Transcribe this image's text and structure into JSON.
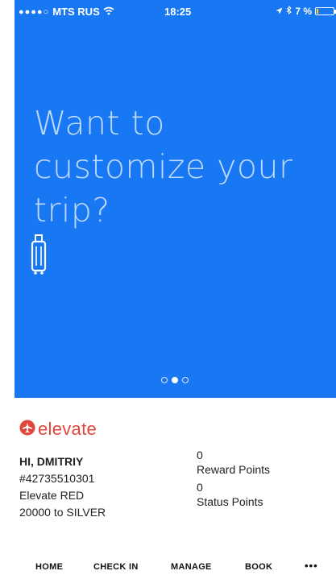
{
  "status_bar": {
    "carrier": "MTS RUS",
    "time": "18:25",
    "battery_text": "7 %",
    "battery_level": 0.07
  },
  "hero": {
    "headline_lines": [
      "Want to",
      "customize your",
      "trip?"
    ],
    "icon": "luggage-icon",
    "pager": {
      "total": 3,
      "active_index": 1
    },
    "background_color": "#1877f2"
  },
  "brand": {
    "name": "elevate",
    "color": "#e2463b"
  },
  "profile": {
    "greeting": "HI, DMITRIY",
    "member_number": "#42735510301",
    "tier": "Elevate RED",
    "progress": "20000 to SILVER"
  },
  "points": {
    "reward_value": "0",
    "reward_label": "Reward Points",
    "status_value": "0",
    "status_label": "Status Points"
  },
  "tabbar": {
    "home": "HOME",
    "check_in": "CHECK IN",
    "manage": "MANAGE",
    "book": "BOOK",
    "more": "•••"
  }
}
